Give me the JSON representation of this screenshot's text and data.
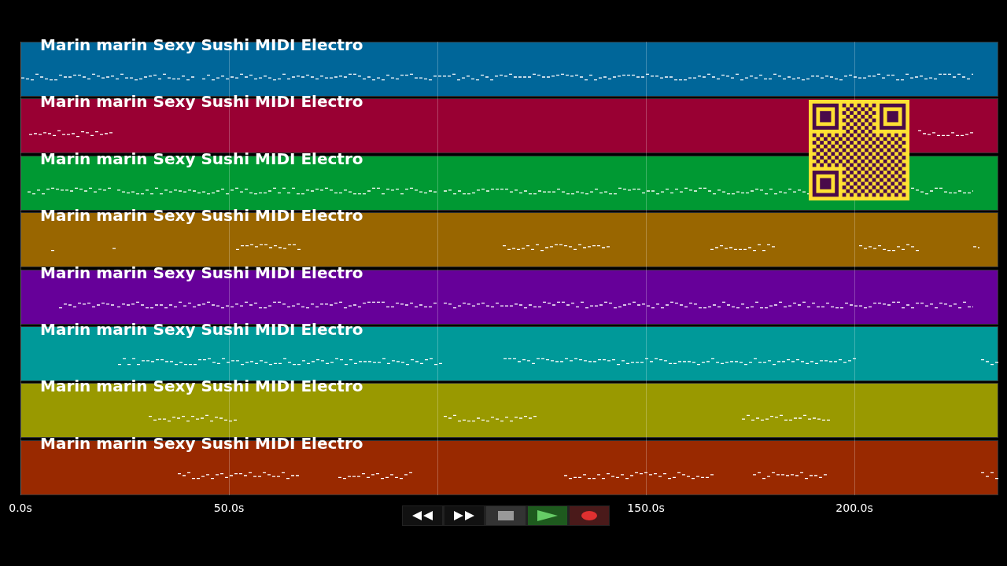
{
  "tracks": [
    {
      "name": "Marin marin Sexy Sushi MIDI Electro",
      "color": "#006699"
    },
    {
      "name": "Marin marin Sexy Sushi MIDI Electro",
      "color": "#990033"
    },
    {
      "name": "Marin marin Sexy Sushi MIDI Electro",
      "color": "#009933"
    },
    {
      "name": "Marin marin Sexy Sushi MIDI Electro",
      "color": "#996600"
    },
    {
      "name": "Marin marin Sexy Sushi MIDI Electro",
      "color": "#660099"
    },
    {
      "name": "Marin marin Sexy Sushi MIDI Electro",
      "color": "#009999"
    },
    {
      "name": "Marin marin Sexy Sushi MIDI Electro",
      "color": "#999900"
    },
    {
      "name": "Marin marin Sexy Sushi MIDI Electro",
      "color": "#992900"
    }
  ],
  "time_axis_left": [
    "0.0s",
    "50.0s"
  ],
  "transport": [
    {
      "kind": "rewind"
    },
    {
      "kind": "forward"
    },
    {
      "kind": "stop"
    },
    {
      "kind": "play"
    },
    {
      "kind": "record"
    }
  ],
  "time_axis_right": [
    "150.0s",
    "200.0s"
  ]
}
